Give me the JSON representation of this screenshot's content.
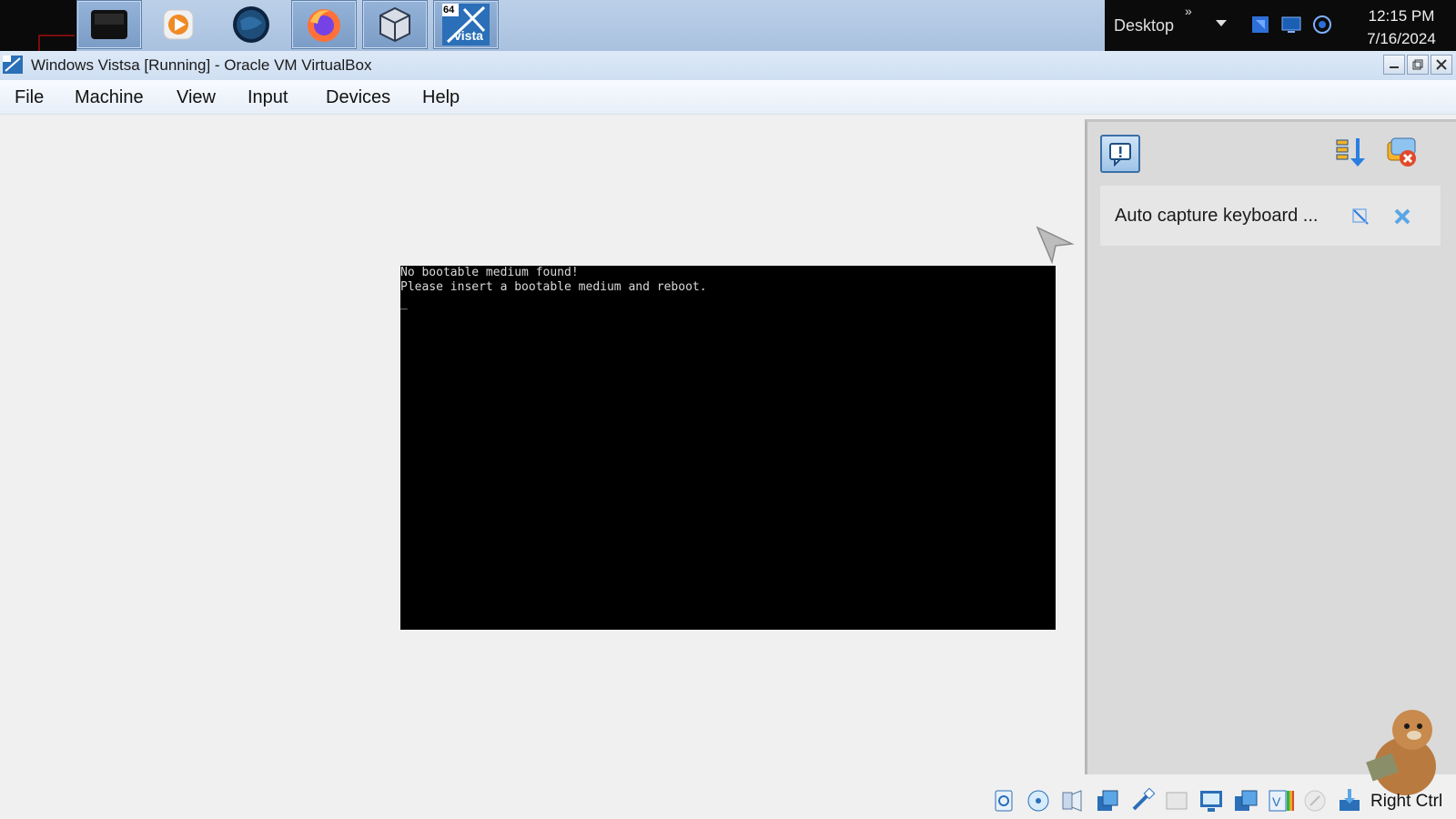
{
  "taskbar": {
    "apps": [
      {
        "name": "dark-app-icon"
      },
      {
        "name": "media-player-icon"
      },
      {
        "name": "globe-icon"
      },
      {
        "name": "firefox-icon"
      },
      {
        "name": "virtualbox-icon"
      },
      {
        "name": "vista-icon",
        "badge": "64",
        "label": "vista"
      }
    ],
    "tray": {
      "desktop_label": "Desktop",
      "chevron": "»",
      "time": "12:15 PM",
      "date": "7/16/2024"
    }
  },
  "window": {
    "title": "Windows Vistsa [Running] - Oracle VM VirtualBox"
  },
  "menu": {
    "items": [
      "File",
      "Machine",
      "View",
      "Input",
      "Devices",
      "Help"
    ]
  },
  "vm_screen": {
    "lines": [
      "No bootable medium found!",
      "Please insert a bootable medium and reboot.",
      "_"
    ]
  },
  "notification_panel": {
    "notice_text": "Auto capture keyboard ...",
    "icons": [
      "notification-center-icon",
      "sort-icon",
      "dismiss-all-icon",
      "notice-info-icon",
      "notice-close-icon"
    ]
  },
  "statusbar": {
    "icons": [
      "hard-disk-icon",
      "optical-drive-icon",
      "audio-icon",
      "network-icon",
      "usb-icon",
      "shared-folders-icon",
      "display-icon",
      "recording-icon",
      "vt-x-icon",
      "mouse-integration-icon",
      "keyboard-capture-icon"
    ],
    "host_key": "Right Ctrl"
  },
  "colors": {
    "accent": "#3b6fa7",
    "vm_background": "#000000",
    "vm_text": "#d9d9d9",
    "panel": "#dadada"
  }
}
